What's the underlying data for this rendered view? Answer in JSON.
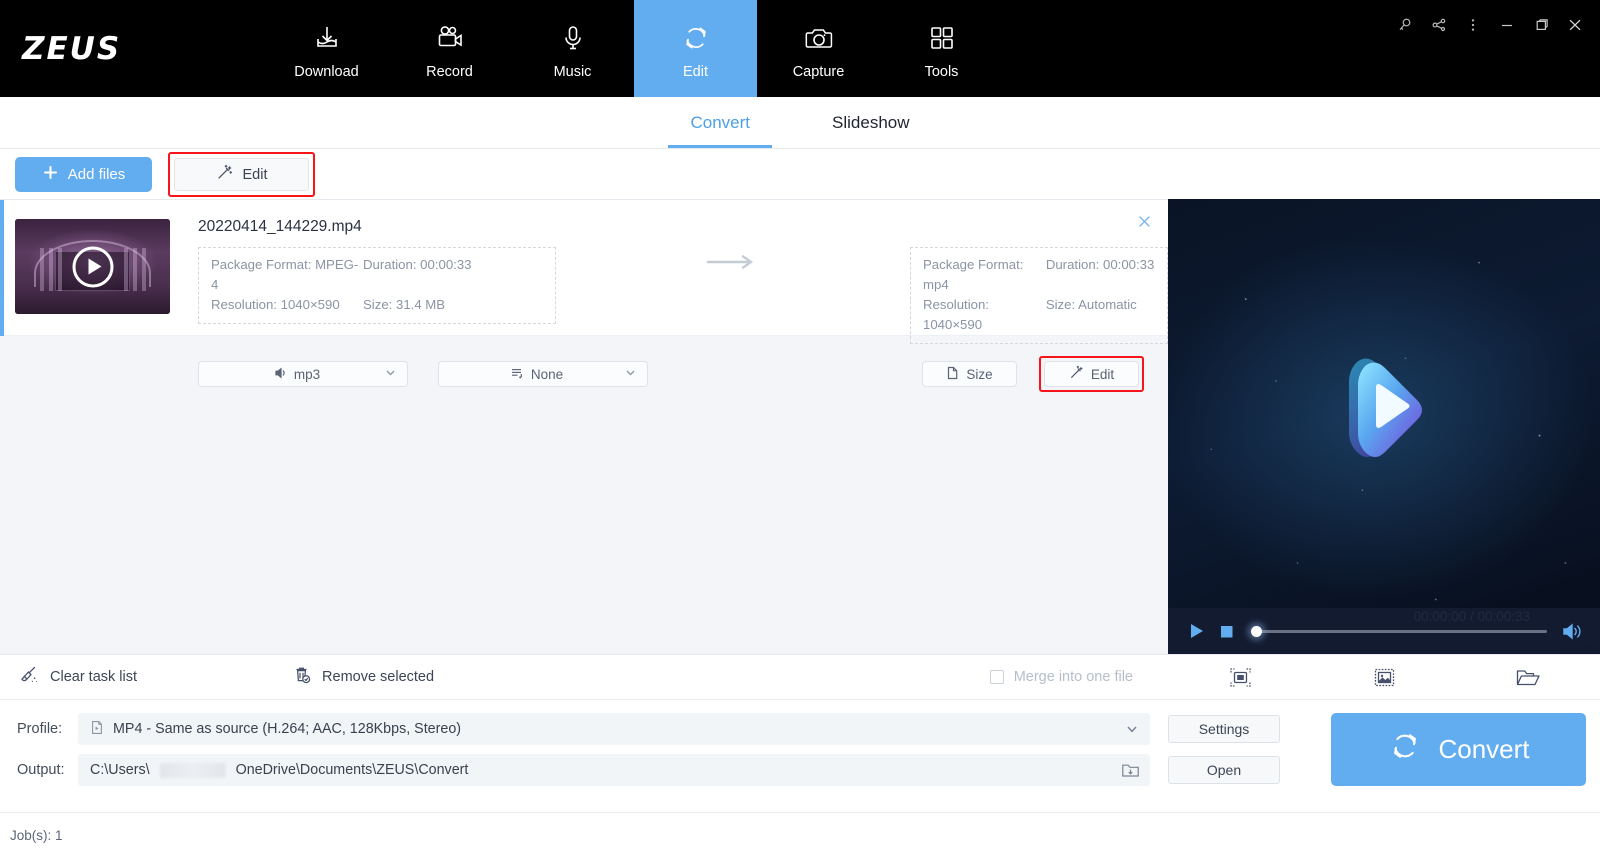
{
  "app": {
    "logo": "ZEUS"
  },
  "nav": {
    "items": [
      {
        "label": "Download",
        "icon": "download-icon",
        "active": false
      },
      {
        "label": "Record",
        "icon": "video-camera-icon",
        "active": false
      },
      {
        "label": "Music",
        "icon": "microphone-icon",
        "active": false
      },
      {
        "label": "Edit",
        "icon": "convert-refresh-icon",
        "active": true
      },
      {
        "label": "Capture",
        "icon": "camera-icon",
        "active": false
      },
      {
        "label": "Tools",
        "icon": "grid-squares-icon",
        "active": false
      }
    ]
  },
  "window_controls": [
    {
      "name": "search-key-icon"
    },
    {
      "name": "share-icon"
    },
    {
      "name": "more-menu-icon"
    },
    {
      "name": "minimize-icon"
    },
    {
      "name": "maximize-icon"
    },
    {
      "name": "close-icon"
    }
  ],
  "tabs": [
    {
      "label": "Convert",
      "active": true
    },
    {
      "label": "Slideshow",
      "active": false
    }
  ],
  "toolbar": {
    "add_files_label": "Add files",
    "edit_label": "Edit",
    "edit_highlighted": true
  },
  "file_item": {
    "filename": "20220414_144229.mp4",
    "source": {
      "package_format_label": "Package Format: MPEG-4",
      "duration_label": "Duration: 00:00:33",
      "resolution_label": "Resolution: 1040×590",
      "size_label": "Size: 31.4 MB"
    },
    "target": {
      "package_format_label": "Package Format: mp4",
      "duration_label": "Duration: 00:00:33",
      "resolution_label": "Resolution: 1040×590",
      "size_label": "Size: Automatic"
    },
    "audio_track": "mp3",
    "subtitle_track": "None",
    "size_button_label": "Size",
    "edit_button_label": "Edit",
    "edit_button_highlighted": true,
    "close_label": "×"
  },
  "preview": {
    "current_time": "00:00:00",
    "total_time": "00:00:33",
    "time_display": "00:00:00 / 00:00:33",
    "seek_position_percent": 0,
    "tools": [
      {
        "name": "fullscreen-icon"
      },
      {
        "name": "snapshot-image-icon"
      },
      {
        "name": "open-folder-icon"
      }
    ]
  },
  "lower_toolbar": {
    "clear_task_list": "Clear task list",
    "remove_selected": "Remove selected",
    "merge_into_one_file": "Merge into one file",
    "merge_checked": false,
    "merge_disabled": true
  },
  "bottom_form": {
    "profile_label": "Profile:",
    "profile_value": "MP4 - Same as source (H.264; AAC, 128Kbps, Stereo)",
    "output_label": "Output:",
    "output_prefix": "C:\\Users\\",
    "output_suffix": "OneDrive\\Documents\\ZEUS\\Convert",
    "settings_label": "Settings",
    "open_label": "Open",
    "convert_label": "Convert"
  },
  "status_bar": {
    "jobs": "Job(s): 1"
  },
  "colors": {
    "accent_blue": "#62ACF0",
    "nav_black": "#000000",
    "highlight_red": "#F5151B",
    "tab_active": "#4D9FE8",
    "field_bg": "#F2F5F8"
  }
}
